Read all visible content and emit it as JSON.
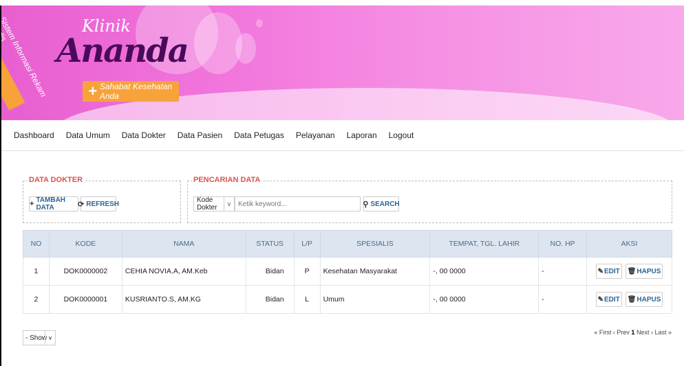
{
  "header": {
    "ribbon_text": "Sistem Informasi Rekam Medis",
    "logo_top": "Klinik",
    "logo_main": "Ananda",
    "tagline": "Sahabat Kesehatan Anda"
  },
  "nav": {
    "items": [
      "Dashboard",
      "Data Umum",
      "Data Dokter",
      "Data Pasien",
      "Data Petugas",
      "Pelayanan",
      "Laporan",
      "Logout"
    ]
  },
  "data_dokter": {
    "legend": "DATA DOKTER",
    "add_label": "TAMBAH DATA",
    "refresh_label": "REFRESH"
  },
  "search": {
    "legend": "PENCARIAN DATA",
    "field_selected": "Kode Dokter",
    "placeholder": "Ketik keyword...",
    "button_label": "SEARCH"
  },
  "table": {
    "headers": [
      "NO",
      "KODE",
      "NAMA",
      "STATUS",
      "L/P",
      "SPESIALIS",
      "TEMPAT, TGL. LAHIR",
      "NO. HP",
      "AKSI"
    ],
    "rows": [
      {
        "no": "1",
        "kode": "DOK0000002",
        "nama": "CEHIA NOVIA.A, AM.Keb",
        "status": "Bidan",
        "lp": "P",
        "spesialis": "Kesehatan Masyarakat",
        "ttl": "-, 00 0000",
        "hp": "-",
        "edit": "EDIT",
        "hapus": "HAPUS"
      },
      {
        "no": "2",
        "kode": "DOK0000001",
        "nama": "KUSRIANTO.S, AM.KG",
        "status": "Bidan",
        "lp": "L",
        "spesialis": "Umum",
        "ttl": "-, 00 0000",
        "hp": "-",
        "edit": "EDIT",
        "hapus": "HAPUS"
      }
    ]
  },
  "footer": {
    "show_selected": "- Show -",
    "pager_first": "« First",
    "pager_prev": "‹ Prev",
    "pager_current": "1",
    "pager_next": "Next ›",
    "pager_last": "Last »"
  },
  "colors": {
    "header_pink": "#e85fd0",
    "ribbon_orange": "#f7a23a",
    "legend_red": "#d9534f",
    "link_blue": "#2a6496",
    "table_header_bg": "#dde6f0"
  }
}
